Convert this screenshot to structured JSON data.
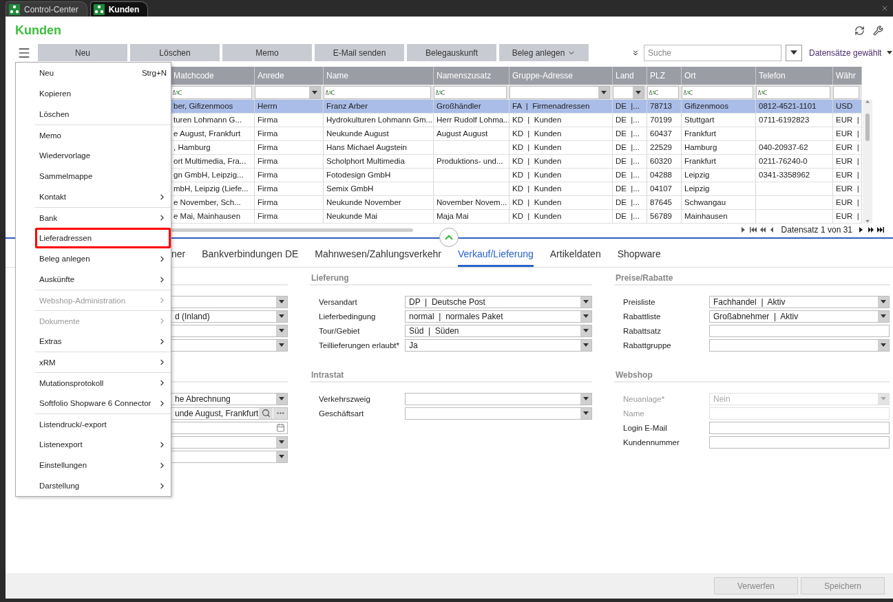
{
  "window_tabs": [
    {
      "label": "Control-Center",
      "selected": false
    },
    {
      "label": "Kunden",
      "selected": true
    }
  ],
  "title": "Kunden",
  "toolbar": {
    "buttons": [
      {
        "label": "Neu",
        "dropdown": false
      },
      {
        "label": "Löschen",
        "dropdown": false
      },
      {
        "label": "Memo",
        "dropdown": false
      },
      {
        "label": "E-Mail senden",
        "dropdown": false
      },
      {
        "label": "Belegauskunft",
        "dropdown": false
      },
      {
        "label": "Beleg anlegen",
        "dropdown": true
      }
    ],
    "search": {
      "placeholder": "Suche"
    },
    "selection": "Datensätze gewählt"
  },
  "table": {
    "columns": [
      {
        "label": "Matchcode",
        "kind": "text"
      },
      {
        "label": "Anrede",
        "kind": "select"
      },
      {
        "label": "Name",
        "kind": "text"
      },
      {
        "label": "Namenszusatz",
        "kind": "text"
      },
      {
        "label": "Gruppe-Adresse",
        "kind": "select"
      },
      {
        "label": "Land",
        "kind": "select"
      },
      {
        "label": "PLZ",
        "kind": "text"
      },
      {
        "label": "Ort",
        "kind": "text"
      },
      {
        "label": "Telefon",
        "kind": "text"
      },
      {
        "label": "Währ",
        "kind": "plain"
      }
    ],
    "rows": [
      {
        "selected": true,
        "cells": [
          "ber, Gifizenmoos",
          "Herrn",
          "Franz Arber",
          "Großhändler",
          "FA  |  Firmenadressen",
          "DE  |...",
          "78713",
          "Gifizenmoos",
          "0812-4521-1101",
          "USD"
        ]
      },
      {
        "selected": false,
        "cells": [
          "turen Lohmann G...",
          "Firma",
          "Hydrokulturen Lohmann Gm...",
          "Herr Rudolf Lohma...",
          "KD  |  Kunden",
          "DE  |...",
          "70199",
          "Stuttgart",
          "0711-6192823",
          "EUR  |"
        ]
      },
      {
        "selected": false,
        "cells": [
          "e August, Frankfurt",
          "Firma",
          "Neukunde August",
          "August August",
          "KD  |  Kunden",
          "DE  |...",
          "60437",
          "Frankfurt",
          null,
          "EUR  |"
        ]
      },
      {
        "selected": false,
        "cells": [
          ", Hamburg",
          "Firma",
          "Hans Michael Augstein",
          null,
          "KD  |  Kunden",
          "DE  |...",
          "22529",
          "Hamburg",
          "040-20937-62",
          "EUR  |"
        ]
      },
      {
        "selected": false,
        "cells": [
          "ort Multimedia, Fra...",
          "Firma",
          "Scholphort Multimedia",
          "Produktions- und...",
          "KD  |  Kunden",
          "DE  |...",
          "60320",
          "Frankfurt",
          "0211-76240-0",
          "EUR  |"
        ]
      },
      {
        "selected": false,
        "cells": [
          "gn GmbH, Leipzig...",
          "Firma",
          "Fotodesign GmbH",
          null,
          "KD  |  Kunden",
          "DE  |...",
          "04288",
          "Leipzig",
          "0341-3358962",
          "EUR  |"
        ]
      },
      {
        "selected": false,
        "cells": [
          "mbH, Leipzig (Liefe...",
          "Firma",
          "Semix GmbH",
          null,
          "KD  |  Kunden",
          "DE  |...",
          "04107",
          "Leipzig",
          null,
          "EUR  |"
        ]
      },
      {
        "selected": false,
        "cells": [
          "e November, Sch...",
          "Firma",
          "Neukunde November",
          "November Novem...",
          "KD  |  Kunden",
          "DE  |...",
          "87645",
          "Schwangau",
          null,
          "EUR  |"
        ]
      },
      {
        "selected": false,
        "cells": [
          "e Mai, Mainhausen",
          "Firma",
          "Neukunde Mai",
          "Maja Mai",
          "KD  |  Kunden",
          "DE  |...",
          "56789",
          "Mainhausen",
          null,
          "EUR  |"
        ]
      }
    ],
    "pager": "Datensatz 1 von 31"
  },
  "detail_tabs": [
    {
      "label": "ner",
      "selected": false
    },
    {
      "label": "Bankverbindungen DE",
      "selected": false
    },
    {
      "label": "Mahnwesen/Zahlungsverkehr",
      "selected": false
    },
    {
      "label": "Verkauf/Lieferung",
      "selected": true
    },
    {
      "label": "Artikeldaten",
      "selected": false
    },
    {
      "label": "Shopware",
      "selected": false
    }
  ],
  "form": {
    "columns": [
      {
        "sections": [
          {
            "fields": [
              {
                "kind": "select"
              },
              {
                "kind": "select",
                "value": "d (Inland)"
              },
              {
                "kind": "select"
              },
              {
                "kind": "select"
              }
            ]
          },
          {
            "fields": [
              {
                "kind": "select",
                "value": "he Abrechnung"
              },
              {
                "kind": "lookup",
                "value": "unde August, Frankfurt"
              },
              {
                "kind": "date"
              },
              {
                "kind": "select"
              },
              {
                "kind": "select"
              }
            ]
          }
        ]
      },
      {
        "sections": [
          {
            "title": "Lieferung",
            "fields": [
              {
                "label": "Versandart",
                "kind": "select",
                "value": "DP  |  Deutsche Post"
              },
              {
                "label": "Lieferbedingung",
                "kind": "select",
                "value": "normal  |  normales Paket"
              },
              {
                "label": "Tour/Gebiet",
                "kind": "select",
                "value": "Süd  |  Süden"
              },
              {
                "label": "Teillieferungen erlaubt*",
                "kind": "select",
                "value": "Ja"
              }
            ]
          },
          {
            "title": "Intrastat",
            "fields": [
              {
                "label": "Verkehrszweig",
                "kind": "select"
              },
              {
                "label": "Geschäftsart",
                "kind": "select"
              }
            ]
          }
        ]
      },
      {
        "sections": [
          {
            "title": "Preise/Rabatte",
            "fields": [
              {
                "label": "Preisliste",
                "kind": "select",
                "value": "Fachhandel  |  Aktiv"
              },
              {
                "label": "Rabattliste",
                "kind": "select",
                "value": "Großabnehmer  |  Aktiv"
              },
              {
                "label": "Rabattsatz",
                "kind": "text"
              },
              {
                "label": "Rabattgruppe",
                "kind": "select"
              }
            ]
          },
          {
            "title": "Webshop",
            "fields": [
              {
                "label": "Neuanlage*",
                "kind": "select",
                "value": "Nein",
                "disabled": true
              },
              {
                "label": "Name",
                "kind": "text",
                "disabled": true
              },
              {
                "label": "Login E-Mail",
                "kind": "text",
                "disabled": false
              },
              {
                "label": "Kundennummer",
                "kind": "text",
                "disabled": false
              }
            ]
          }
        ]
      }
    ]
  },
  "menu": {
    "items": [
      {
        "label": "Neu",
        "shortcut": "Strg+N",
        "submenu": false,
        "disabled": false,
        "separator_before": false,
        "highlighted": false
      },
      {
        "label": "Kopieren",
        "submenu": false,
        "disabled": false,
        "separator_before": false,
        "highlighted": false
      },
      {
        "label": "Löschen",
        "submenu": false,
        "disabled": false,
        "separator_before": false,
        "highlighted": false
      },
      {
        "label": "Memo",
        "submenu": false,
        "disabled": false,
        "separator_before": true,
        "highlighted": false
      },
      {
        "label": "Wiedervorlage",
        "submenu": false,
        "disabled": false,
        "separator_before": false,
        "highlighted": false
      },
      {
        "label": "Sammelmappe",
        "submenu": false,
        "disabled": false,
        "separator_before": false,
        "highlighted": false
      },
      {
        "label": "Kontakt",
        "submenu": true,
        "disabled": false,
        "separator_before": false,
        "highlighted": false
      },
      {
        "label": "Bank",
        "submenu": true,
        "disabled": false,
        "separator_before": true,
        "highlighted": false
      },
      {
        "label": "Lieferadressen",
        "submenu": false,
        "disabled": false,
        "separator_before": false,
        "highlighted": true
      },
      {
        "label": "Beleg anlegen",
        "submenu": true,
        "disabled": false,
        "separator_before": false,
        "highlighted": false
      },
      {
        "label": "Auskünfte",
        "submenu": true,
        "disabled": false,
        "separator_before": false,
        "highlighted": false
      },
      {
        "label": "Webshop-Administration",
        "submenu": true,
        "disabled": true,
        "separator_before": true,
        "highlighted": false
      },
      {
        "label": "Dokumente",
        "submenu": true,
        "disabled": true,
        "separator_before": true,
        "highlighted": false
      },
      {
        "label": "Extras",
        "submenu": true,
        "disabled": false,
        "separator_before": false,
        "highlighted": false
      },
      {
        "label": "xRM",
        "submenu": true,
        "disabled": false,
        "separator_before": true,
        "highlighted": false
      },
      {
        "label": "Mutationsprotokoll",
        "submenu": true,
        "disabled": false,
        "separator_before": true,
        "highlighted": false
      },
      {
        "label": "Softfolio Shopware 6 Connector",
        "submenu": true,
        "disabled": false,
        "separator_before": false,
        "highlighted": false
      },
      {
        "label": "Listendruck/-export",
        "submenu": false,
        "disabled": false,
        "separator_before": true,
        "highlighted": false
      },
      {
        "label": "Listenexport",
        "submenu": true,
        "disabled": false,
        "separator_before": false,
        "highlighted": false
      },
      {
        "label": "Einstellungen",
        "submenu": true,
        "disabled": false,
        "separator_before": false,
        "highlighted": false
      },
      {
        "label": "Darstellung",
        "submenu": true,
        "disabled": false,
        "separator_before": false,
        "highlighted": false
      }
    ]
  },
  "footer": {
    "buttons": [
      {
        "label": "Verwerfen",
        "disabled": true
      },
      {
        "label": "Speichern",
        "disabled": true
      }
    ]
  }
}
